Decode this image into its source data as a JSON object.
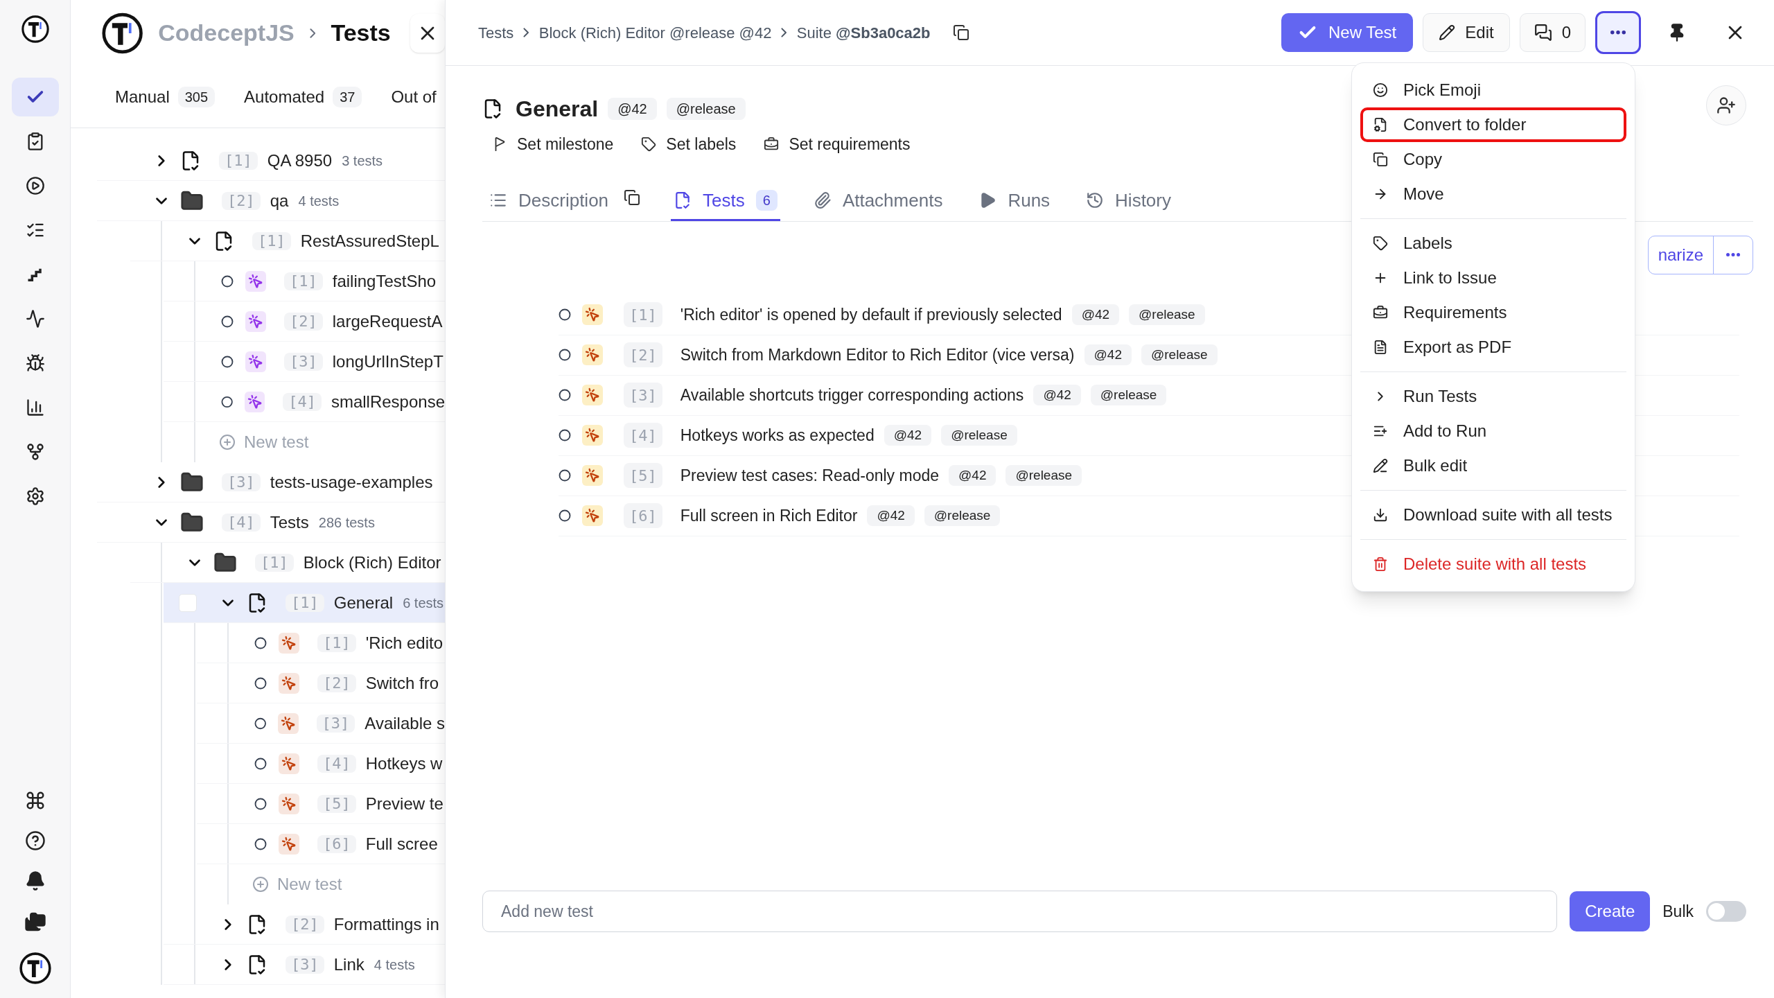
{
  "rail": [
    {
      "selected": true
    },
    {
      "selected": false
    },
    {
      "selected": false
    },
    {
      "selected": false
    },
    {
      "selected": false
    },
    {
      "selected": false
    },
    {
      "selected": false
    },
    {
      "selected": false
    },
    {
      "selected": false
    },
    {
      "selected": false
    }
  ],
  "project": {
    "name": "CodeceptJS",
    "page": "Tests"
  },
  "tree_tabs": [
    {
      "label": "Manual",
      "count": "305"
    },
    {
      "label": "Automated",
      "count": "37"
    },
    {
      "label": "Out of"
    }
  ],
  "tree": [
    {
      "kind": "suite",
      "index": "[1]",
      "name": "QA 8950",
      "count": "3 tests",
      "expanded": false,
      "selected": false
    },
    {
      "kind": "folder",
      "index": "[2]",
      "name": "qa",
      "count": "4 tests",
      "expanded": true,
      "selected": false,
      "children": [
        {
          "kind": "suite",
          "index": "[1]",
          "name": "RestAssuredStepL",
          "expanded": true,
          "selected": false,
          "children": [
            {
              "kind": "test",
              "color": "#9333ea",
              "index": "[1]",
              "name": "failingTestSho",
              "selected": false
            },
            {
              "kind": "test",
              "color": "#9333ea",
              "index": "[2]",
              "name": "largeRequestA",
              "selected": false
            },
            {
              "kind": "test",
              "color": "#9333ea",
              "index": "[3]",
              "name": "longUrlInStepT",
              "selected": false
            },
            {
              "kind": "test",
              "color": "#9333ea",
              "index": "[4]",
              "name": "smallResponse",
              "selected": false
            },
            {
              "kind": "new",
              "label": "New test"
            }
          ]
        }
      ]
    },
    {
      "kind": "folder",
      "index": "[3]",
      "name": "tests-usage-examples",
      "expanded": false,
      "selected": false
    },
    {
      "kind": "folder",
      "index": "[4]",
      "name": "Tests",
      "count": "286 tests",
      "expanded": true,
      "selected": false,
      "children": [
        {
          "kind": "folder",
          "index": "[1]",
          "name": "Block (Rich) Editor",
          "expanded": true,
          "selected": false,
          "children": [
            {
              "kind": "suite",
              "index": "[1]",
              "name": "General",
              "count": "6 tests",
              "expanded": true,
              "selected": true,
              "children": [
                {
                  "kind": "test",
                  "color": "#c2410c",
                  "index": "[1]",
                  "name": "'Rich edito",
                  "selected": false
                },
                {
                  "kind": "test",
                  "color": "#c2410c",
                  "index": "[2]",
                  "name": "Switch fro",
                  "selected": false
                },
                {
                  "kind": "test",
                  "color": "#c2410c",
                  "index": "[3]",
                  "name": "Available s",
                  "selected": false
                },
                {
                  "kind": "test",
                  "color": "#c2410c",
                  "index": "[4]",
                  "name": "Hotkeys w",
                  "selected": false
                },
                {
                  "kind": "test",
                  "color": "#c2410c",
                  "index": "[5]",
                  "name": "Preview te",
                  "selected": false
                },
                {
                  "kind": "test",
                  "color": "#c2410c",
                  "index": "[6]",
                  "name": "Full scree",
                  "selected": false
                },
                {
                  "kind": "new",
                  "label": "New test"
                }
              ]
            },
            {
              "kind": "suite",
              "index": "[2]",
              "name": "Formattings in",
              "expanded": false,
              "selected": false
            },
            {
              "kind": "suite",
              "index": "[3]",
              "name": "Link",
              "count": "4 tests",
              "expanded": false,
              "selected": false
            }
          ]
        }
      ]
    }
  ],
  "breadcrumb": {
    "items": [
      "Tests",
      "Block (Rich) Editor @release @42"
    ],
    "suite_label": "Suite",
    "suite_id": "@Sb3a0ca2b"
  },
  "toolbar": {
    "new_test": "New Test",
    "edit": "Edit",
    "comments": "0",
    "more_selected": true
  },
  "suite": {
    "title": "General",
    "tags": [
      "@42",
      "@release"
    ],
    "actions": [
      "Set milestone",
      "Set labels",
      "Set requirements"
    ]
  },
  "tabs": [
    {
      "label": "Description",
      "selected": false
    },
    {
      "label": "Tests",
      "count": "6",
      "selected": true
    },
    {
      "label": "Attachments",
      "selected": false
    },
    {
      "label": "Runs",
      "selected": false
    },
    {
      "label": "History",
      "selected": false
    }
  ],
  "partial_button": "narize",
  "tests": [
    {
      "index": "[1]",
      "title": "'Rich editor' is opened by default if previously selected",
      "tags": [
        "@42",
        "@release"
      ]
    },
    {
      "index": "[2]",
      "title": "Switch from Markdown Editor to Rich Editor (vice versa)",
      "tags": [
        "@42",
        "@release"
      ]
    },
    {
      "index": "[3]",
      "title": "Available shortcuts trigger corresponding actions",
      "tags": [
        "@42",
        "@release"
      ]
    },
    {
      "index": "[4]",
      "title": "Hotkeys works as expected",
      "tags": [
        "@42",
        "@release"
      ]
    },
    {
      "index": "[5]",
      "title": "Preview test cases: Read-only mode",
      "tags": [
        "@42",
        "@release"
      ]
    },
    {
      "index": "[6]",
      "title": "Full screen in Rich Editor",
      "tags": [
        "@42",
        "@release"
      ]
    }
  ],
  "new_test": {
    "placeholder": "Add new test",
    "button": "Create",
    "bulk_label": "Bulk",
    "bulk_on": false
  },
  "menu": {
    "groups": [
      [
        {
          "label": "Pick Emoji",
          "highlighted": false,
          "danger": false
        },
        {
          "label": "Convert to folder",
          "highlighted": true,
          "danger": false
        },
        {
          "label": "Copy",
          "highlighted": false,
          "danger": false
        },
        {
          "label": "Move",
          "highlighted": false,
          "danger": false
        }
      ],
      [
        {
          "label": "Labels",
          "highlighted": false,
          "danger": false
        },
        {
          "label": "Link to Issue",
          "highlighted": false,
          "danger": false
        },
        {
          "label": "Requirements",
          "highlighted": false,
          "danger": false
        },
        {
          "label": "Export as PDF",
          "highlighted": false,
          "danger": false
        }
      ],
      [
        {
          "label": "Run Tests",
          "highlighted": false,
          "danger": false
        },
        {
          "label": "Add to Run",
          "highlighted": false,
          "danger": false
        },
        {
          "label": "Bulk edit",
          "highlighted": false,
          "danger": false
        }
      ],
      [
        {
          "label": "Download suite with all tests",
          "highlighted": false,
          "danger": false
        }
      ],
      [
        {
          "label": "Delete suite with all tests",
          "highlighted": false,
          "danger": true
        }
      ]
    ]
  }
}
